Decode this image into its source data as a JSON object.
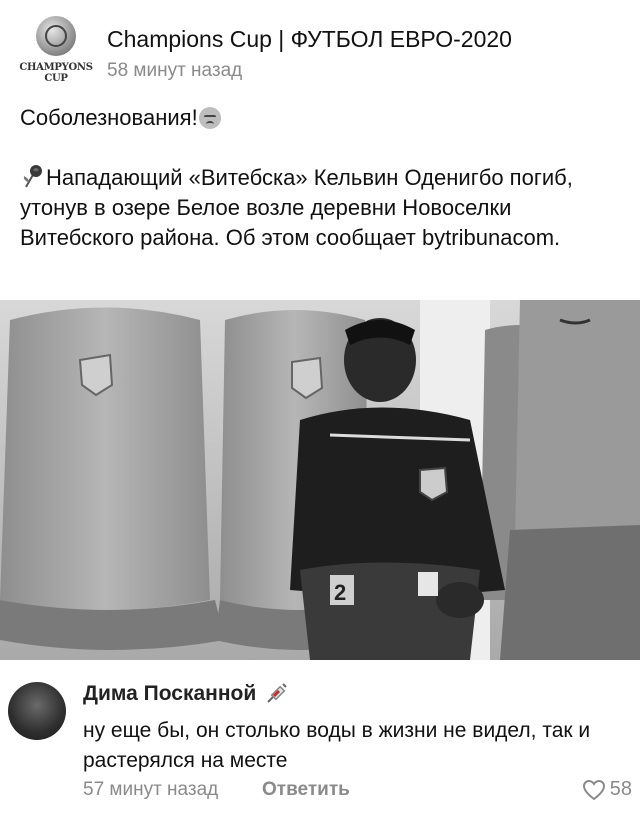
{
  "post": {
    "channel_name": "Champions Cup | ФУТБОЛ ЕВРО-2020",
    "avatar_text": "CHAMPYONS CUP",
    "time": "58 минут назад",
    "text_line1": "Соболезнования!",
    "text_para2": "Нападающий «Витебска» Кельвин Оденигбо погиб, утонув в озере Белое возле деревни Новоселки Витебского района. Об этом сообщает bytribunacom.",
    "icons": [
      "sad-face-emoji",
      "rose-icon"
    ]
  },
  "photo": {
    "description_icon": "football-player-bench-photo",
    "shirt_number": "2"
  },
  "comment": {
    "author": "Дима Посканной",
    "author_badge_icon": "syringe-icon",
    "text": "ну еще бы, он столько воды в жизни не видел, так и растерялся на месте",
    "time": "57 минут назад",
    "reply_label": "Ответить",
    "likes": "58"
  }
}
